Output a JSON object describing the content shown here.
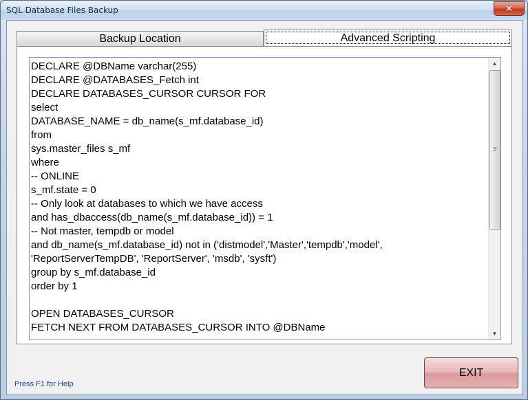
{
  "window": {
    "title": "SQL Database Files Backup",
    "close_glyph": "✕"
  },
  "tabs": [
    {
      "label": "Backup Location",
      "selected": false
    },
    {
      "label": "Advanced Scripting",
      "selected": true
    }
  ],
  "script": {
    "lines": [
      "DECLARE @DBName varchar(255)",
      "DECLARE @DATABASES_Fetch int",
      "DECLARE DATABASES_CURSOR CURSOR FOR",
      "select",
      "DATABASE_NAME = db_name(s_mf.database_id)",
      "from",
      "sys.master_files s_mf",
      "where",
      "-- ONLINE",
      "s_mf.state = 0",
      "-- Only look at databases to which we have access",
      "and has_dbaccess(db_name(s_mf.database_id)) = 1",
      "-- Not master, tempdb or model",
      "and db_name(s_mf.database_id) not in ('distmodel','Master','tempdb','model',",
      "'ReportServerTempDB', 'ReportServer', 'msdb', 'sysft')",
      "group by s_mf.database_id",
      "order by 1",
      "",
      "OPEN DATABASES_CURSOR",
      "FETCH NEXT FROM DATABASES_CURSOR INTO @DBName"
    ]
  },
  "scrollbar": {
    "up_icon": "scroll-up-arrow",
    "down_icon": "scroll-down-arrow",
    "position_fraction": 0
  },
  "footer": {
    "help_text": "Press F1 for Help",
    "exit_label": "EXIT"
  },
  "colors": {
    "help_text": "#1f3fa8",
    "exit_button": "#e8b8b8",
    "close_button": "#c1361d"
  }
}
